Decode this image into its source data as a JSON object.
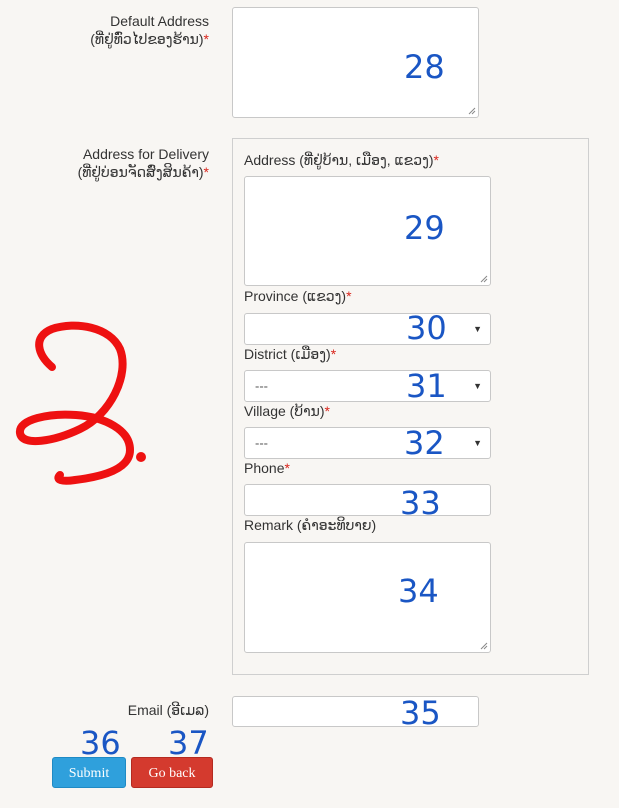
{
  "form": {
    "default_address": {
      "label": "Default Address",
      "label_lao": "(ທີ່ຢູ່ທົ່ວໄປຂອງຮ້ານ)",
      "required_mark": "*",
      "value": ""
    },
    "delivery": {
      "label": "Address for Delivery",
      "label_lao": "(ທີ່ຢູ່ບ່ອນຈັດສົ່ງສິນຄ້າ)",
      "required_mark": "*",
      "address": {
        "label": "Address (ທີ່ຢູ່ບ້ານ, ເມືອງ, ແຂວງ)",
        "required_mark": "*",
        "value": ""
      },
      "province": {
        "label": "Province (ແຂວງ)",
        "required_mark": "*",
        "selected": ""
      },
      "district": {
        "label": "District (ເມືອງ)",
        "required_mark": "*",
        "selected": "---"
      },
      "village": {
        "label": "Village (ບ້ານ)",
        "required_mark": "*",
        "selected": "---"
      },
      "phone": {
        "label": "Phone",
        "required_mark": "*",
        "value": ""
      },
      "remark": {
        "label": "Remark (ຄຳອະທິບາຍ)",
        "value": ""
      }
    },
    "email": {
      "label": "Email (ອີເມລ)",
      "value": ""
    },
    "buttons": {
      "submit": "Submit",
      "back": "Go back"
    }
  },
  "annotations": {
    "n28": "28",
    "n29": "29",
    "n30": "30",
    "n31": "31",
    "n32": "32",
    "n33": "33",
    "n34": "34",
    "n35": "35",
    "n36": "36",
    "n37": "37",
    "handwritten_glyph": "ຂ."
  },
  "colors": {
    "background": "#f8f6f3",
    "required": "#d9251c",
    "annotation_blue": "#1a56c4",
    "annotation_red": "#ee1111",
    "submit": "#2fa0dc",
    "back": "#d43a2e"
  }
}
